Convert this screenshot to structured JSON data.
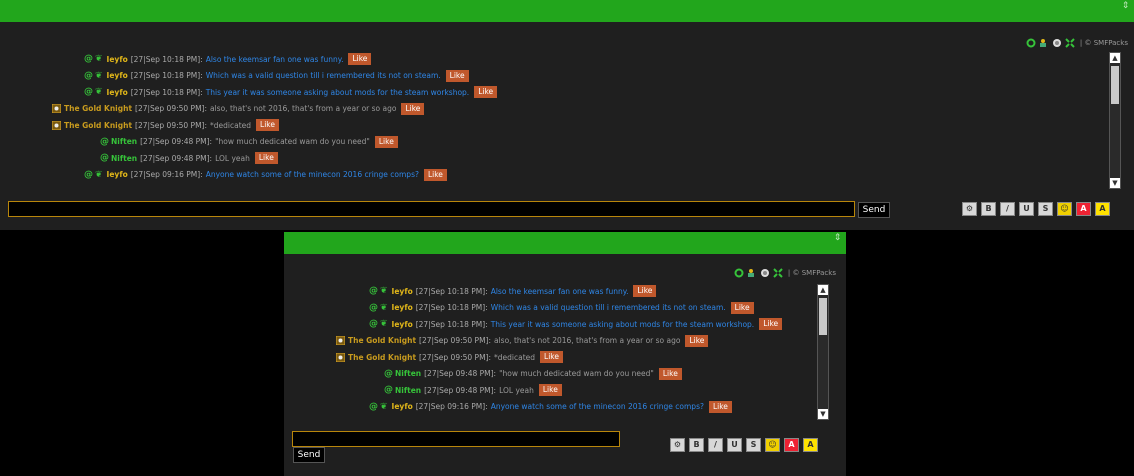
{
  "toolbar": {
    "credit": "| © SMFPacks"
  },
  "messages": [
    {
      "kind": "ieyfo",
      "user": "Ieyfo",
      "time": "[27|Sep 10:18 PM]:",
      "text": "Also the keemsar fan one was funny.",
      "like": "Like"
    },
    {
      "kind": "ieyfo",
      "user": "Ieyfo",
      "time": "[27|Sep 10:18 PM]:",
      "text": "Which was a valid question till i remembered its not on steam.",
      "like": "Like"
    },
    {
      "kind": "ieyfo",
      "user": "Ieyfo",
      "time": "[27|Sep 10:18 PM]:",
      "text": "This year it was someone asking about mods for the steam workshop.",
      "like": "Like"
    },
    {
      "kind": "gold",
      "user": "The Gold Knight",
      "time": "[27|Sep 09:50 PM]:",
      "text": "also, that's not 2016, that's from a year or so ago",
      "like": "Like"
    },
    {
      "kind": "gold",
      "user": "The Gold Knight",
      "time": "[27|Sep 09:50 PM]:",
      "text": "*dedicated",
      "like": "Like"
    },
    {
      "kind": "niften",
      "user": "Niften",
      "time": "[27|Sep 09:48 PM]:",
      "text": "\"how much dedicated wam do you need\"",
      "like": "Like"
    },
    {
      "kind": "niften",
      "user": "Niften",
      "time": "[27|Sep 09:48 PM]:",
      "text": "LOL yeah",
      "like": "Like"
    },
    {
      "kind": "ieyfo",
      "user": "Ieyfo",
      "time": "[27|Sep 09:16 PM]:",
      "text": "Anyone watch some of the minecon 2016 cringe comps?",
      "like": "Like"
    }
  ],
  "send_label": "Send",
  "format_buttons": [
    "⚙",
    "B",
    "/",
    "U",
    "S",
    "☺",
    "A",
    "A"
  ],
  "colors": {
    "header_green": "#22a61c",
    "ieyfo": "#e0b619",
    "gold": "#c89b1e",
    "niften": "#36c33a",
    "text_blue": "#2f86e6",
    "like_bg": "#c0582c"
  }
}
